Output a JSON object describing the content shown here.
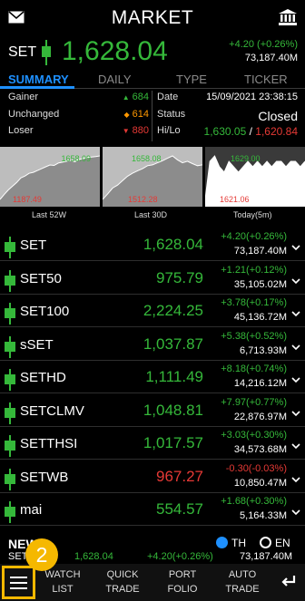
{
  "header": {
    "title": "MARKET",
    "mail_icon": "mail-icon",
    "bank_icon": "bank-icon"
  },
  "index": {
    "symbol": "SET",
    "price": "1,628.04",
    "change": "+4.20 (+0.26%)",
    "volume": "73,187.40M"
  },
  "tabs": [
    "SUMMARY",
    "DAILY",
    "TYPE",
    "TICKER"
  ],
  "stats": {
    "gainer_label": "Gainer",
    "gainer": "684",
    "unchanged_label": "Unchanged",
    "unchanged": "614",
    "loser_label": "Loser",
    "loser": "880",
    "date_label": "Date",
    "date": "15/09/2021 23:38:15",
    "status_label": "Status",
    "status": "Closed",
    "hilo_label": "Hi/Lo",
    "hi": "1,630.05",
    "slash": "/",
    "lo": "1,620.84"
  },
  "chart_data": [
    {
      "type": "area",
      "label": "Last 52W",
      "high": "1658.09",
      "low": "1187.49",
      "values": [
        1187,
        1240,
        1290,
        1330,
        1370,
        1420,
        1440,
        1470,
        1480,
        1500,
        1520,
        1540,
        1560,
        1555,
        1580,
        1590,
        1600,
        1610,
        1595,
        1620,
        1630,
        1640,
        1645,
        1650,
        1658
      ]
    },
    {
      "type": "area",
      "label": "Last 30D",
      "high": "1658.08",
      "low": "1512.28",
      "values": [
        1512,
        1530,
        1550,
        1560,
        1575,
        1590,
        1600,
        1608,
        1615,
        1625,
        1628,
        1635,
        1642,
        1650,
        1658,
        1645,
        1635,
        1640,
        1632,
        1625,
        1628
      ]
    },
    {
      "type": "area",
      "label": "Today(5m)",
      "high": "1629.00",
      "low": "1621.06",
      "values": [
        1621,
        1628,
        1629,
        1627,
        1626,
        1628,
        1627,
        1626,
        1627,
        1628,
        1627,
        1628,
        1627,
        1628,
        1627,
        1628,
        1628,
        1627,
        1628,
        1628,
        1627,
        1628
      ]
    }
  ],
  "indices": [
    {
      "name": "SET",
      "price": "1,628.04",
      "change": "+4.20(+0.26%)",
      "volume": "73,187.40M",
      "color": "#35b83a"
    },
    {
      "name": "SET50",
      "price": "975.79",
      "change": "+1.21(+0.12%)",
      "volume": "35,105.02M",
      "color": "#35b83a"
    },
    {
      "name": "SET100",
      "price": "2,224.25",
      "change": "+3.78(+0.17%)",
      "volume": "45,136.72M",
      "color": "#35b83a"
    },
    {
      "name": "sSET",
      "price": "1,037.87",
      "change": "+5.38(+0.52%)",
      "volume": "6,713.93M",
      "color": "#35b83a"
    },
    {
      "name": "SETHD",
      "price": "1,111.49",
      "change": "+8.18(+0.74%)",
      "volume": "14,216.12M",
      "color": "#35b83a"
    },
    {
      "name": "SETCLMV",
      "price": "1,048.81",
      "change": "+7.97(+0.77%)",
      "volume": "22,876.97M",
      "color": "#35b83a"
    },
    {
      "name": "SETTHSI",
      "price": "1,017.57",
      "change": "+3.03(+0.30%)",
      "volume": "34,573.68M",
      "color": "#35b83a"
    },
    {
      "name": "SETWB",
      "price": "967.27",
      "change": "-0.30(-0.03%)",
      "volume": "10,850.47M",
      "color": "#e53935"
    },
    {
      "name": "mai",
      "price": "554.57",
      "change": "+1.68(+0.30%)",
      "volume": "5,164.33M",
      "color": "#35b83a"
    }
  ],
  "news": {
    "title": "NEWS",
    "lang_th": "TH",
    "lang_en": "EN"
  },
  "ticker": {
    "symbol": "SET",
    "price": "1,628.04",
    "change": "+4.20(+0.26%)",
    "volume": "73,187.40M"
  },
  "badge": "2",
  "nav": {
    "watch": "WATCH",
    "list": "LIST",
    "quick": "QUICK",
    "trade": "TRADE",
    "port": "PORT",
    "folio": "FOLIO",
    "auto": "AUTO",
    "trade2": "TRADE"
  }
}
